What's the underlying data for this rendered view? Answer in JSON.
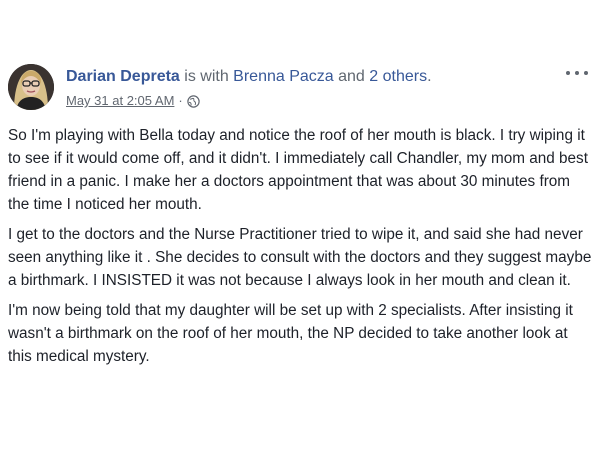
{
  "post": {
    "author": "Darian Depreta",
    "with_text": " is with ",
    "tagged_person": "Brenna Pacza",
    "and_text": " and ",
    "others": "2 others",
    "period": ".",
    "timestamp": "May 31 at 2:05 AM",
    "separator": " · ",
    "privacy_icon": "globe-icon",
    "more_icon": "more-options-icon",
    "paragraphs": [
      "So I'm playing with Bella today and notice the roof of her mouth is black. I try wiping it to see if it would come off, and it didn't. I immediately call Chandler, my mom and best friend in a panic. I make her a doctors appointment that was about 30 minutes from the time I noticed her mouth.",
      "I get to the doctors and the Nurse Practitioner tried to wipe it, and said she had never seen anything like it . She decides to consult with the doctors and they suggest maybe a birthmark. I INSISTED it was not because I always look in her mouth and clean it.",
      "I'm now being told that my daughter will be set up with 2 specialists. After insisting it wasn't a birthmark on the roof of her mouth, the NP decided to take another look at this medical mystery."
    ]
  },
  "colors": {
    "link": "#385898",
    "meta": "#616770",
    "text": "#1d2129"
  }
}
